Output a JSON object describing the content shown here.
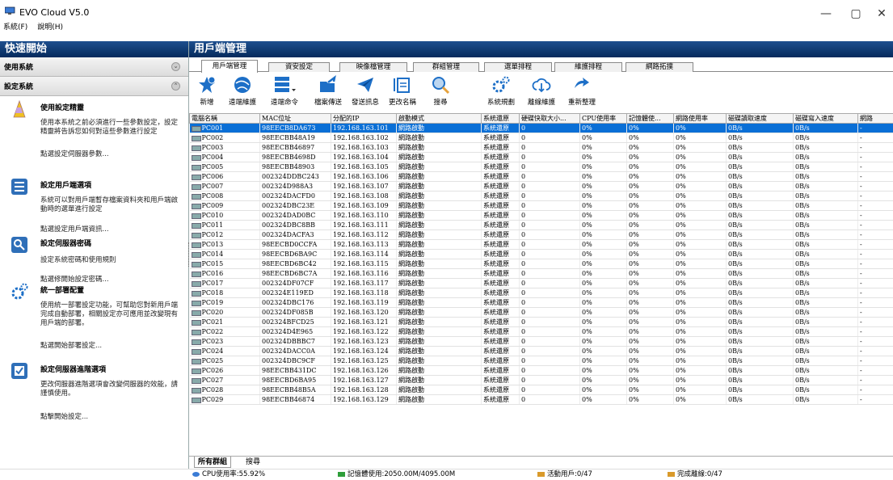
{
  "app": {
    "title": "EVO Cloud  V5.0",
    "menu": [
      "系統(F)",
      "說明(H)"
    ]
  },
  "window_controls": {
    "minimize": "—",
    "restore": "▢",
    "close": "✕"
  },
  "left_panel": {
    "header": "快速開始",
    "sections": [
      {
        "label": "使用系統"
      },
      {
        "label": "設定系統"
      }
    ],
    "tasks": [
      {
        "icon": "wizard-hat-icon",
        "title": "使用設定精靈",
        "desc": "使用本系統之前必須進行一些參數設定，設定精靈將告訴您如何對這些參數進行設定",
        "link": "點選設定伺服器參數..."
      },
      {
        "icon": "client-options-icon",
        "title": "設定用戶端選項",
        "desc": "系統可以對用戶端暫存檔案資料夾和用戶端啟動時的選單進行設定",
        "link": "點選設定用戶端資訊..."
      },
      {
        "icon": "key-icon",
        "title": "設定伺服器密碼",
        "desc": "設定系統密碼和使用規則",
        "link": "點選修開始設定密碼..."
      },
      {
        "icon": "gears-icon",
        "title": "統一部署配置",
        "desc": "使用統一部署設定功能，可幫助您對新用戶端完成自動部署，相關設定亦可應用並改變現有用戶端的部署。",
        "link": "點選開始部署設定..."
      },
      {
        "icon": "checkbox-icon",
        "title": "設定伺服器進階選項",
        "desc": "更改伺服器進階選項會改變伺服器的效能，請謹慎使用。",
        "link": "點擊開始設定..."
      }
    ]
  },
  "main": {
    "header": "用戶端管理",
    "tabs": [
      "用戶端管理",
      "資安設定",
      "映像檔管理",
      "群組管理",
      "選單排程",
      "維護排程",
      "網路拓撲"
    ],
    "toolbar": [
      "新增",
      "遠端維護",
      "遠端命令",
      "檔案傳送",
      "發送訊息",
      "更改名稱",
      "搜尋",
      "系統規劃",
      "離線維護",
      "重新整理"
    ],
    "columns": [
      "電腦名稱",
      "MAC位址",
      "分配的IP",
      "啟動模式",
      "系統還原",
      "硬碟快取大小...",
      "CPU使用率",
      "記憶體使...",
      "網路使用率",
      "磁碟讀取速度",
      "磁碟寫入速度",
      "網路"
    ],
    "rows": [
      [
        "PC001",
        "98EECB8DA673",
        "192.168.163.101",
        "網路啟動",
        "系統還原",
        "0",
        "0%",
        "0%",
        "0%",
        "0B/s",
        "0B/s",
        "-"
      ],
      [
        "PC002",
        "98EECBB48A19",
        "192.168.163.102",
        "網路啟動",
        "系統還原",
        "0",
        "0%",
        "0%",
        "0%",
        "0B/s",
        "0B/s",
        "-"
      ],
      [
        "PC003",
        "98EECBB46897",
        "192.168.163.103",
        "網路啟動",
        "系統還原",
        "0",
        "0%",
        "0%",
        "0%",
        "0B/s",
        "0B/s",
        "-"
      ],
      [
        "PC004",
        "98EECBB4698D",
        "192.168.163.104",
        "網路啟動",
        "系統還原",
        "0",
        "0%",
        "0%",
        "0%",
        "0B/s",
        "0B/s",
        "-"
      ],
      [
        "PC005",
        "98EECBB48903",
        "192.168.163.105",
        "網路啟動",
        "系統還原",
        "0",
        "0%",
        "0%",
        "0%",
        "0B/s",
        "0B/s",
        "-"
      ],
      [
        "PC006",
        "002324DDBC243",
        "192.168.163.106",
        "網路啟動",
        "系統還原",
        "0",
        "0%",
        "0%",
        "0%",
        "0B/s",
        "0B/s",
        "-"
      ],
      [
        "PC007",
        "002324D988A3",
        "192.168.163.107",
        "網路啟動",
        "系統還原",
        "0",
        "0%",
        "0%",
        "0%",
        "0B/s",
        "0B/s",
        "-"
      ],
      [
        "PC008",
        "002324DACFD0",
        "192.168.163.108",
        "網路啟動",
        "系統還原",
        "0",
        "0%",
        "0%",
        "0%",
        "0B/s",
        "0B/s",
        "-"
      ],
      [
        "PC009",
        "002324DBC23E",
        "192.168.163.109",
        "網路啟動",
        "系統還原",
        "0",
        "0%",
        "0%",
        "0%",
        "0B/s",
        "0B/s",
        "-"
      ],
      [
        "PC010",
        "002324DAD0BC",
        "192.168.163.110",
        "網路啟動",
        "系統還原",
        "0",
        "0%",
        "0%",
        "0%",
        "0B/s",
        "0B/s",
        "-"
      ],
      [
        "PC011",
        "002324DBC8BB",
        "192.168.163.111",
        "網路啟動",
        "系統還原",
        "0",
        "0%",
        "0%",
        "0%",
        "0B/s",
        "0B/s",
        "-"
      ],
      [
        "PC012",
        "002324DACFA3",
        "192.168.163.112",
        "網路啟動",
        "系統還原",
        "0",
        "0%",
        "0%",
        "0%",
        "0B/s",
        "0B/s",
        "-"
      ],
      [
        "PC013",
        "98EECBD0CCFA",
        "192.168.163.113",
        "網路啟動",
        "系統還原",
        "0",
        "0%",
        "0%",
        "0%",
        "0B/s",
        "0B/s",
        "-"
      ],
      [
        "PC014",
        "98EECBD6BA9C",
        "192.168.163.114",
        "網路啟動",
        "系統還原",
        "0",
        "0%",
        "0%",
        "0%",
        "0B/s",
        "0B/s",
        "-"
      ],
      [
        "PC015",
        "98EECBD6BC42",
        "192.168.163.115",
        "網路啟動",
        "系統還原",
        "0",
        "0%",
        "0%",
        "0%",
        "0B/s",
        "0B/s",
        "-"
      ],
      [
        "PC016",
        "98EECBD6BC7A",
        "192.168.163.116",
        "網路啟動",
        "系統還原",
        "0",
        "0%",
        "0%",
        "0%",
        "0B/s",
        "0B/s",
        "-"
      ],
      [
        "PC017",
        "002324DF07CF",
        "192.168.163.117",
        "網路啟動",
        "系統還原",
        "0",
        "0%",
        "0%",
        "0%",
        "0B/s",
        "0B/s",
        "-"
      ],
      [
        "PC018",
        "002324E119ED",
        "192.168.163.118",
        "網路啟動",
        "系統還原",
        "0",
        "0%",
        "0%",
        "0%",
        "0B/s",
        "0B/s",
        "-"
      ],
      [
        "PC019",
        "002324DBC176",
        "192.168.163.119",
        "網路啟動",
        "系統還原",
        "0",
        "0%",
        "0%",
        "0%",
        "0B/s",
        "0B/s",
        "-"
      ],
      [
        "PC020",
        "002324DF085B",
        "192.168.163.120",
        "網路啟動",
        "系統還原",
        "0",
        "0%",
        "0%",
        "0%",
        "0B/s",
        "0B/s",
        "-"
      ],
      [
        "PC021",
        "002324BFCD25",
        "192.168.163.121",
        "網路啟動",
        "系統還原",
        "0",
        "0%",
        "0%",
        "0%",
        "0B/s",
        "0B/s",
        "-"
      ],
      [
        "PC022",
        "002324D4E965",
        "192.168.163.122",
        "網路啟動",
        "系統還原",
        "0",
        "0%",
        "0%",
        "0%",
        "0B/s",
        "0B/s",
        "-"
      ],
      [
        "PC023",
        "002324DBBBC7",
        "192.168.163.123",
        "網路啟動",
        "系統還原",
        "0",
        "0%",
        "0%",
        "0%",
        "0B/s",
        "0B/s",
        "-"
      ],
      [
        "PC024",
        "002324DACC0A",
        "192.168.163.124",
        "網路啟動",
        "系統還原",
        "0",
        "0%",
        "0%",
        "0%",
        "0B/s",
        "0B/s",
        "-"
      ],
      [
        "PC025",
        "002324DBC9CF",
        "192.168.163.125",
        "網路啟動",
        "系統還原",
        "0",
        "0%",
        "0%",
        "0%",
        "0B/s",
        "0B/s",
        "-"
      ],
      [
        "PC026",
        "98EECBB431DC",
        "192.168.163.126",
        "網路啟動",
        "系統還原",
        "0",
        "0%",
        "0%",
        "0%",
        "0B/s",
        "0B/s",
        "-"
      ],
      [
        "PC027",
        "98EECBD6BA95",
        "192.168.163.127",
        "網路啟動",
        "系統還原",
        "0",
        "0%",
        "0%",
        "0%",
        "0B/s",
        "0B/s",
        "-"
      ],
      [
        "PC028",
        "98EECBB48B5A",
        "192.168.163.128",
        "網路啟動",
        "系統還原",
        "0",
        "0%",
        "0%",
        "0%",
        "0B/s",
        "0B/s",
        "-"
      ],
      [
        "PC029",
        "98EECBB46874",
        "192.168.163.129",
        "網路啟動",
        "系統還原",
        "0",
        "0%",
        "0%",
        "0%",
        "0B/s",
        "0B/s",
        "-"
      ]
    ],
    "selected_row": 0,
    "bottom_tabs": [
      "所有群組",
      "搜尋"
    ]
  },
  "status": {
    "cpu": "CPU使用率:55.92%",
    "memory": "記憶體使用:2050.00M/4095.00M",
    "active_clients": "活動用戶:0/47",
    "offline_done": "完成離線:0/47"
  },
  "colors": {
    "header_blue": "#052a5c",
    "selection": "#0a6fd6",
    "accent": "#1d6fc7"
  }
}
